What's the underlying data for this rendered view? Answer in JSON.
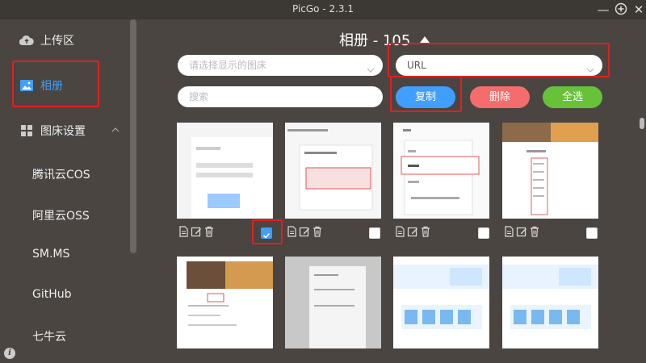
{
  "window": {
    "title": "PicGo - 2.3.1"
  },
  "sidebar": {
    "items": [
      {
        "label": "上传区",
        "icon": "cloud-upload-icon"
      },
      {
        "label": "相册",
        "icon": "image-icon",
        "active": true
      },
      {
        "label": "图床设置",
        "icon": "grid-icon"
      }
    ],
    "sub_items": [
      "腾讯云COS",
      "阿里云OSS",
      "SM.MS",
      "GitHub",
      "七牛云"
    ]
  },
  "gallery": {
    "title": "相册 - 105",
    "bed_select_placeholder": "请选择显示的图床",
    "format_select_value": "URL",
    "search_placeholder": "搜索",
    "buttons": {
      "copy": "复制",
      "delete": "删除",
      "select_all": "全选"
    },
    "checked": [
      true,
      false,
      false,
      false
    ]
  },
  "colors": {
    "accent": "#409eff",
    "danger": "#f56c6c",
    "success": "#67c23a",
    "background": "#4a4541"
  }
}
